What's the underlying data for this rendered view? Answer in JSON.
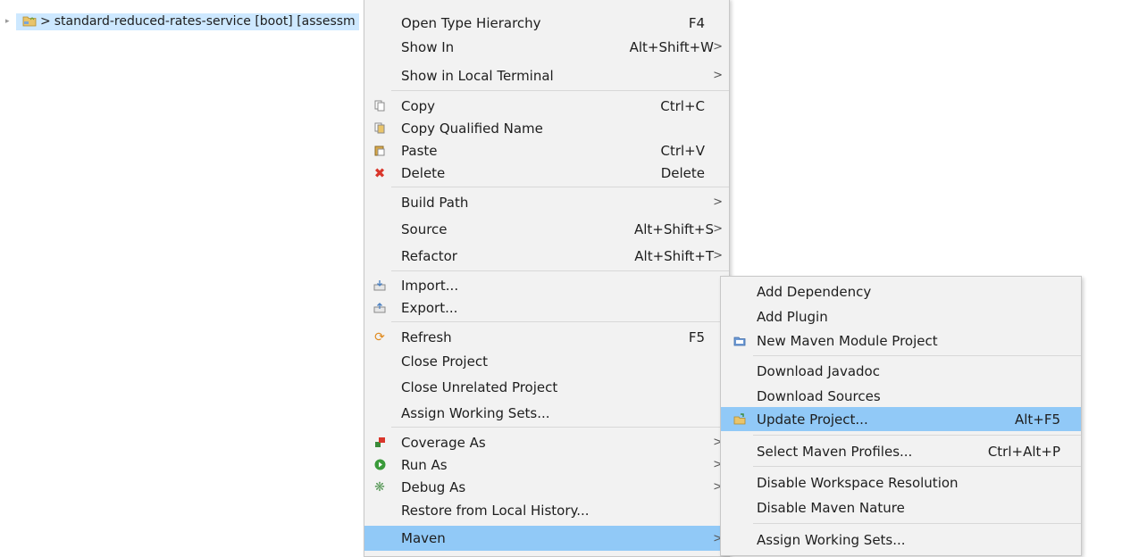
{
  "tree": {
    "project_label": "standard-reduced-rates-service [boot] [assessm",
    "prefix": ">"
  },
  "context_menu": {
    "items": [
      {
        "label": "Open Type Hierarchy",
        "shortcut": "F4"
      },
      {
        "label": "Show In",
        "shortcut": "Alt+Shift+W"
      },
      {
        "label": "Show in Local Terminal",
        "shortcut": ""
      },
      {
        "label": "Copy",
        "shortcut": "Ctrl+C"
      },
      {
        "label": "Copy Qualified Name",
        "shortcut": ""
      },
      {
        "label": "Paste",
        "shortcut": "Ctrl+V"
      },
      {
        "label": "Delete",
        "shortcut": "Delete"
      },
      {
        "label": "Build Path",
        "shortcut": ""
      },
      {
        "label": "Source",
        "shortcut": "Alt+Shift+S"
      },
      {
        "label": "Refactor",
        "shortcut": "Alt+Shift+T"
      },
      {
        "label": "Import...",
        "shortcut": ""
      },
      {
        "label": "Export...",
        "shortcut": ""
      },
      {
        "label": "Refresh",
        "shortcut": "F5"
      },
      {
        "label": "Close Project",
        "shortcut": ""
      },
      {
        "label": "Close Unrelated Project",
        "shortcut": ""
      },
      {
        "label": "Assign Working Sets...",
        "shortcut": ""
      },
      {
        "label": "Coverage As",
        "shortcut": ""
      },
      {
        "label": "Run As",
        "shortcut": ""
      },
      {
        "label": "Debug As",
        "shortcut": ""
      },
      {
        "label": "Restore from Local History...",
        "shortcut": ""
      },
      {
        "label": "Maven",
        "shortcut": ""
      }
    ],
    "submenu_arrow": ">"
  },
  "maven_menu": {
    "items": [
      {
        "label": "Add Dependency",
        "shortcut": ""
      },
      {
        "label": "Add Plugin",
        "shortcut": ""
      },
      {
        "label": "New Maven Module Project",
        "shortcut": ""
      },
      {
        "label": "Download Javadoc",
        "shortcut": ""
      },
      {
        "label": "Download Sources",
        "shortcut": ""
      },
      {
        "label": "Update Project...",
        "shortcut": "Alt+F5"
      },
      {
        "label": "Select Maven Profiles...",
        "shortcut": "Ctrl+Alt+P"
      },
      {
        "label": "Disable Workspace Resolution",
        "shortcut": ""
      },
      {
        "label": "Disable Maven Nature",
        "shortcut": ""
      },
      {
        "label": "Assign Working Sets...",
        "shortcut": ""
      }
    ]
  },
  "colors": {
    "menu_bg": "#f2f2f2",
    "highlight": "#91c9f7",
    "tree_selection": "#cde8ff",
    "delete_icon": "#d9362b"
  }
}
